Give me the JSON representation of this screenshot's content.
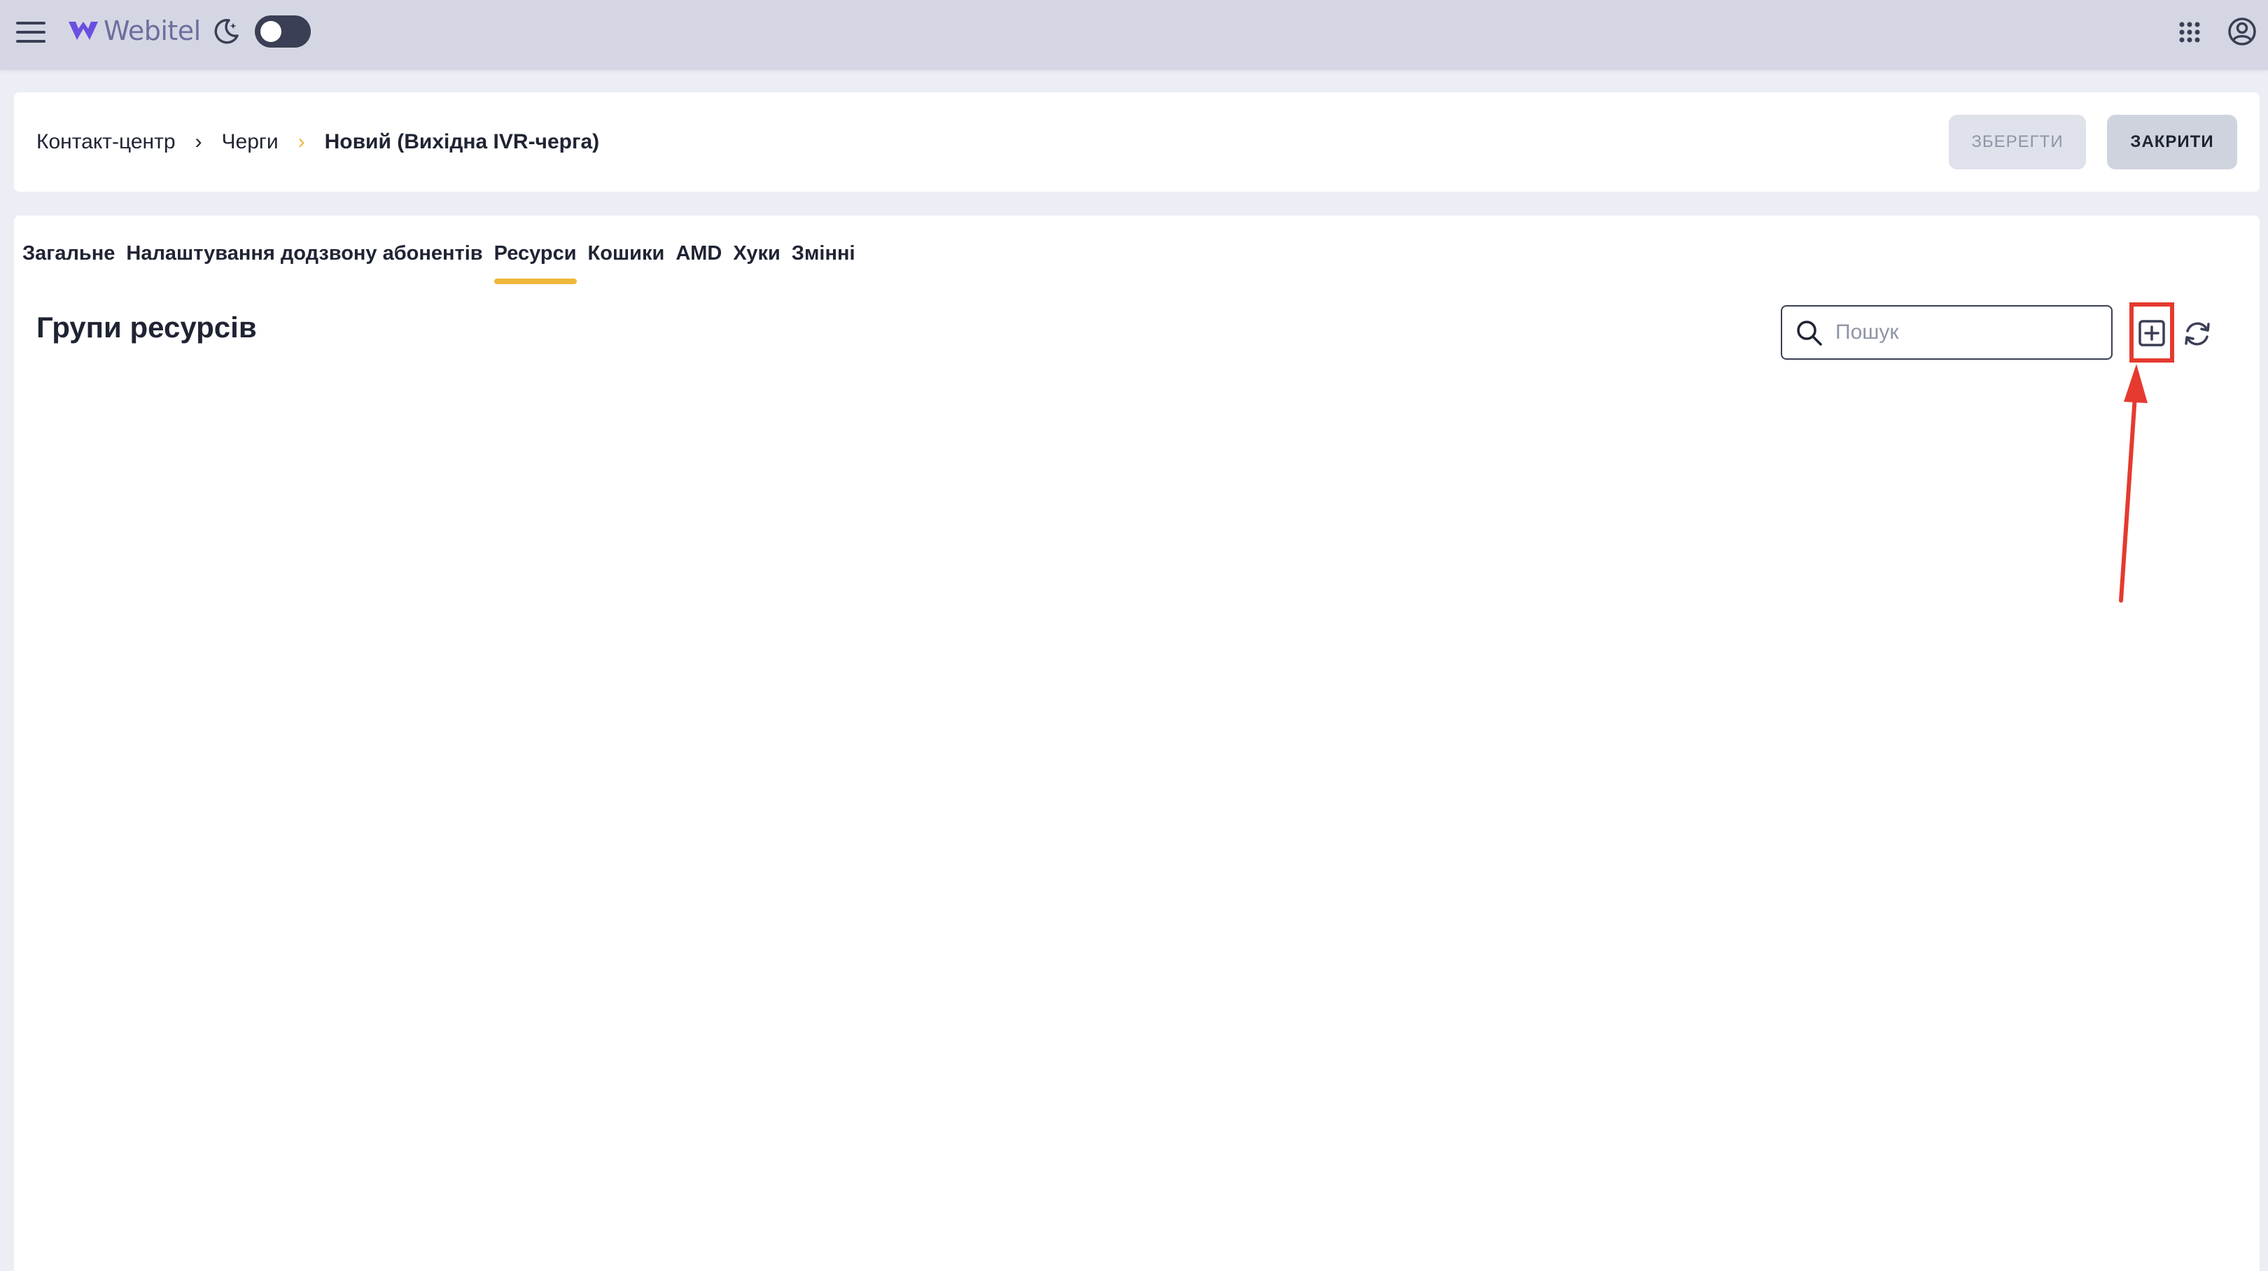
{
  "app": {
    "logo_text": "Webitel",
    "brand_color": "#6b4fe0"
  },
  "topbar": {
    "menu_icon": "hamburger-menu-icon",
    "theme_icon": "moon-icon",
    "theme_toggle_on": true,
    "apps_icon": "apps-grid-icon",
    "account_icon": "user-account-icon"
  },
  "breadcrumb": {
    "items": [
      "Контакт-центр",
      "Черги",
      "Новий (Вихідна IVR-черга)"
    ]
  },
  "actions": {
    "save_label": "ЗБЕРЕГТИ",
    "close_label": "ЗАКРИТИ"
  },
  "tabs": [
    {
      "label": "Загальне",
      "active": false
    },
    {
      "label": "Налаштування додзвону абонентів",
      "active": false
    },
    {
      "label": "Ресурси",
      "active": true
    },
    {
      "label": "Кошики",
      "active": false
    },
    {
      "label": "AMD",
      "active": false
    },
    {
      "label": "Хуки",
      "active": false
    },
    {
      "label": "Змінні",
      "active": false
    }
  ],
  "section": {
    "title": "Групи ресурсів",
    "search_placeholder": "Пошук",
    "add_icon": "add-square-icon",
    "refresh_icon": "refresh-icon"
  },
  "annotation": {
    "highlight_color": "#e53a2f"
  }
}
